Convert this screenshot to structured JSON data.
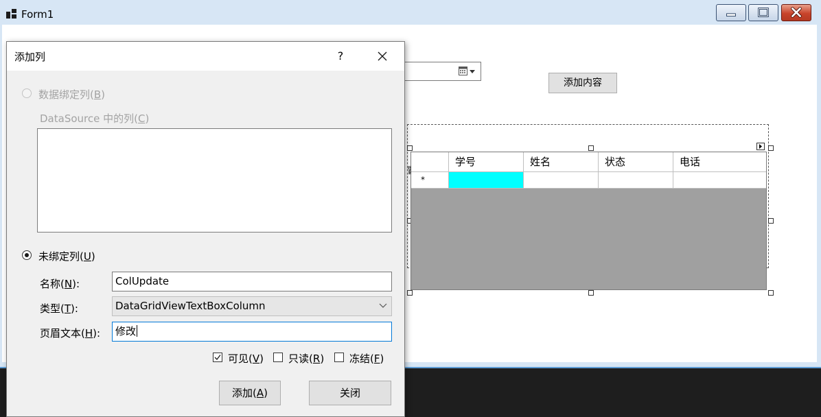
{
  "window": {
    "title": "Form1"
  },
  "form": {
    "add_content_button": "添加内容",
    "grid": {
      "columns": [
        "学号",
        "姓名",
        "状态",
        "电话"
      ],
      "new_row_indicator": "*",
      "clipped_label": "冒"
    }
  },
  "dialog": {
    "title": "添加列",
    "help": "?",
    "databound_radio": {
      "label": "数据绑定列",
      "key": "B"
    },
    "datasource_label": {
      "label": "DataSource 中的列",
      "key": "C"
    },
    "unbound_radio": {
      "label": "未绑定列",
      "key": "U"
    },
    "name_label": {
      "label": "名称",
      "key": "N",
      "suffix": ":"
    },
    "name_value": "ColUpdate",
    "type_label": {
      "label": "类型",
      "key": "T",
      "suffix": ":"
    },
    "type_value": "DataGridViewTextBoxColumn",
    "header_label": {
      "label": "页眉文本",
      "key": "H",
      "suffix": ":"
    },
    "header_value": "修改",
    "visible_check": {
      "label": "可见",
      "key": "V",
      "checked": true
    },
    "readonly_check": {
      "label": "只读",
      "key": "R",
      "checked": false
    },
    "frozen_check": {
      "label": "冻结",
      "key": "F",
      "checked": false
    },
    "add_button": {
      "label": "添加",
      "key": "A"
    },
    "close_button": "关闭"
  },
  "colors": {
    "selected_cell": "#00ffff",
    "grid_background": "#a0a0a0",
    "focus_border": "#0078d7"
  }
}
